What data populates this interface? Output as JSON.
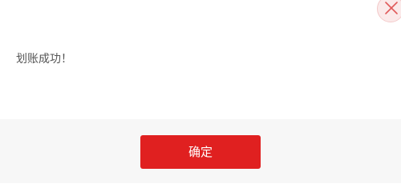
{
  "dialog": {
    "message": "划账成功！",
    "confirm_label": "确定",
    "close_icon": "close-icon"
  },
  "colors": {
    "accent": "#e02020",
    "footer_bg": "#f7f7f7",
    "close_bg": "#fbeaea",
    "close_icon": "#e05a5a",
    "message_text": "#555555"
  }
}
